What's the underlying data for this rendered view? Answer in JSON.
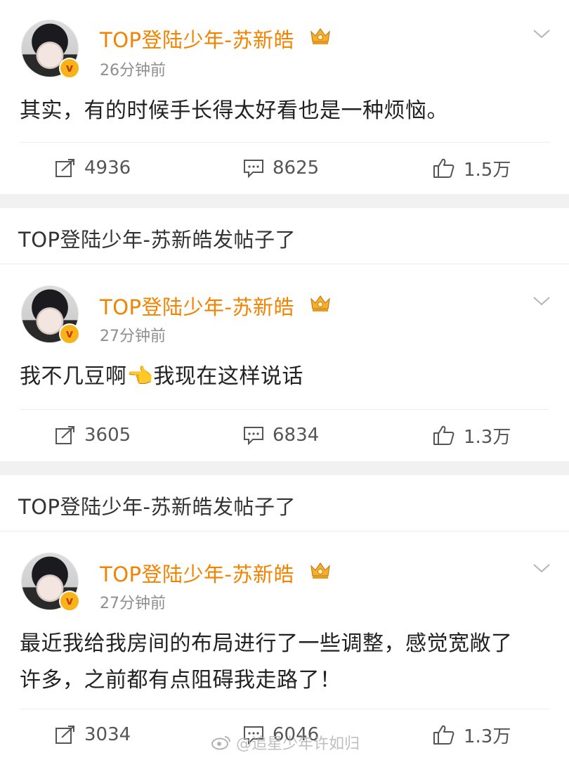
{
  "posts": [
    {
      "username": "TOP登陆少年-苏新皓",
      "time": "26分钟前",
      "text": "其实，有的时候手长得太好看也是一种烦恼。",
      "reposts": "4936",
      "comments": "8625",
      "likes": "1.5万"
    },
    {
      "repost_header": "TOP登陆少年-苏新皓发帖子了",
      "username": "TOP登陆少年-苏新皓",
      "time": "27分钟前",
      "text": "我不几豆啊👈我现在这样说话",
      "reposts": "3605",
      "comments": "6834",
      "likes": "1.3万"
    },
    {
      "repost_header": "TOP登陆少年-苏新皓发帖子了",
      "username": "TOP登陆少年-苏新皓",
      "time": "27分钟前",
      "text_line1": "最近我给我房间的布局进行了一些调整，感觉宽敞了",
      "text_line2": "许多，之前都有点阻碍我走路了！",
      "reposts": "3034",
      "comments": "6046",
      "likes": "1.3万"
    }
  ],
  "watermark": "@追星少年许如归",
  "icons": {
    "verified": "v-badge-icon",
    "crown": "crown-icon",
    "more": "chevron-down-icon",
    "repost": "repost-icon",
    "comment": "comment-icon",
    "like": "thumbs-up-icon"
  },
  "colors": {
    "username": "#f18300",
    "badge": "#f8b31a",
    "separator": "#f1f1f1"
  }
}
